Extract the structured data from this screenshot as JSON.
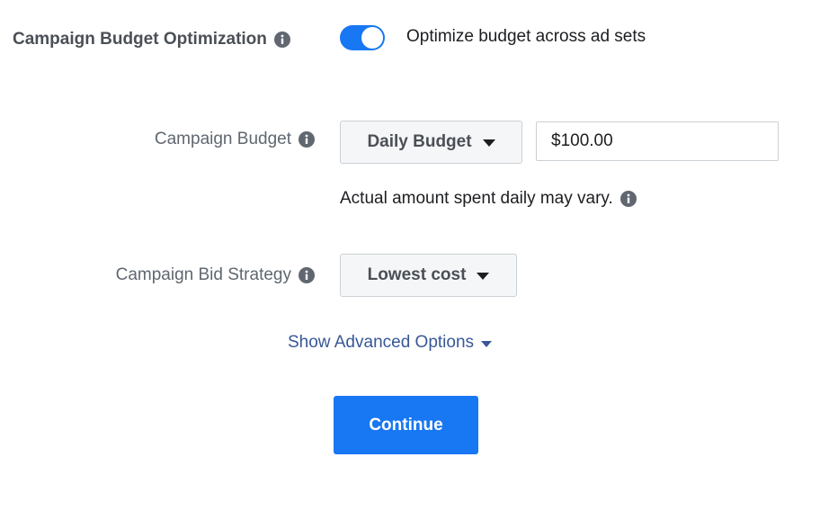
{
  "cbo": {
    "label": "Campaign Budget Optimization",
    "info_icon": "info-icon",
    "toggle_on": true,
    "toggle_color": "#1877f2",
    "toggle_text": "Optimize budget across ad sets"
  },
  "budget": {
    "label": "Campaign Budget",
    "info_icon": "info-icon",
    "type_selected": "Daily Budget",
    "amount": "$100.00",
    "hint": "Actual amount spent daily may vary."
  },
  "bid": {
    "label": "Campaign Bid Strategy",
    "info_icon": "info-icon",
    "selected": "Lowest cost"
  },
  "advanced": {
    "label": "Show Advanced Options",
    "color": "#385898"
  },
  "actions": {
    "continue_label": "Continue",
    "primary_color": "#1877f2"
  }
}
